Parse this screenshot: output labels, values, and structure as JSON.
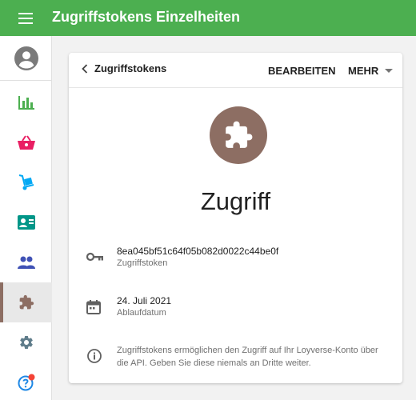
{
  "topbar": {
    "title": "Zugriffstokens Einzelheiten",
    "menu_icon": "hamburger-menu-icon"
  },
  "sidebar": {
    "items": [
      {
        "name": "avatar",
        "icon": "account-circle-icon",
        "color": "#7a7a7a"
      },
      {
        "name": "reports",
        "icon": "bar-chart-icon",
        "color": "#4caf50"
      },
      {
        "name": "sales",
        "icon": "basket-icon",
        "color": "#e91e63"
      },
      {
        "name": "items",
        "icon": "dolly-icon",
        "color": "#03a9f4"
      },
      {
        "name": "customers",
        "icon": "contact-card-icon",
        "color": "#009688"
      },
      {
        "name": "employees",
        "icon": "people-icon",
        "color": "#3f51b5"
      },
      {
        "name": "integrations",
        "icon": "puzzle-icon",
        "color": "#8d6e63",
        "active": true
      },
      {
        "name": "settings",
        "icon": "gear-icon",
        "color": "#607d8b"
      },
      {
        "name": "help",
        "icon": "help-circle-icon",
        "color": "#1e88e5",
        "badge_color": "#f44336"
      }
    ]
  },
  "card": {
    "back_label": "Zugriffstokens",
    "edit_label": "BEARBEITEN",
    "more_label": "MEHR",
    "token_name": "Zugriff",
    "icon_color": "#8d6e63",
    "token": {
      "value": "8ea045bf51c64f05b082d0022c44be0f",
      "label": "Zugriffstoken"
    },
    "expiry": {
      "value": "24. Juli 2021",
      "label": "Ablaufdatum"
    },
    "info": "Zugriffstokens ermöglichen den Zugriff auf Ihr Loyverse-Konto über die API. Geben Sie diese niemals an Dritte weiter."
  }
}
